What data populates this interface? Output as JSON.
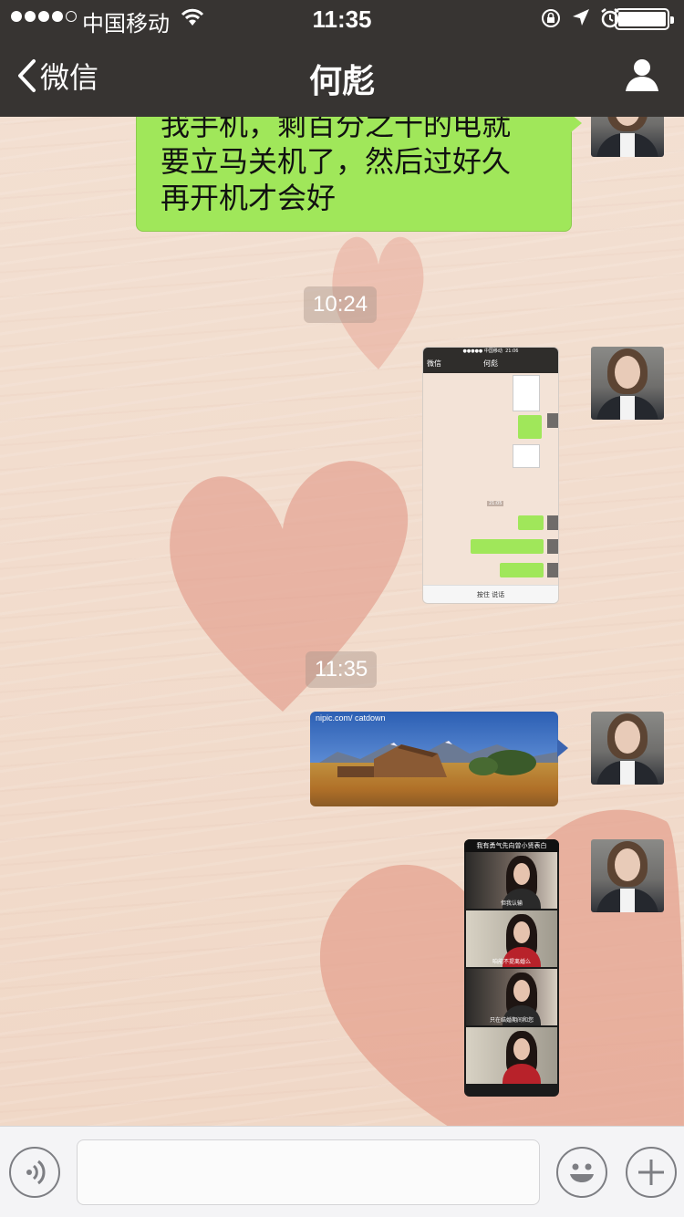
{
  "status_bar": {
    "carrier": "中国移动",
    "time": "11:35",
    "signal_bars_filled": 4,
    "signal_bars_total": 5,
    "battery_level": 1.0
  },
  "nav": {
    "back_label": "微信",
    "title": "何彪"
  },
  "messages": [
    {
      "type": "text",
      "sender": "me",
      "lines": [
        "我手机，剩百分之十的电就",
        "要立马关机了，然后过好久",
        "再开机才会好"
      ]
    },
    {
      "type": "timestamp",
      "text": "10:24"
    },
    {
      "type": "image",
      "sender": "me",
      "content": "screenshot",
      "thumbnail": {
        "status_carrier": "●●●●● 中国移动",
        "status_time": "21:06",
        "back_label": "微信",
        "title": "何彪",
        "time_badge": "21:05",
        "input_label": "按住 说话"
      }
    },
    {
      "type": "timestamp",
      "text": "11:35"
    },
    {
      "type": "image",
      "sender": "me",
      "content": "landscape-photo",
      "watermark": "nipic.com/ catdown"
    },
    {
      "type": "image",
      "sender": "me",
      "content": "meme-strip",
      "caption": "我有勇气先向曾小贤表白",
      "subtitles": [
        "但我认输",
        "咱能不提离婚么",
        "只在结婚期间和您",
        ""
      ]
    }
  ],
  "input_bar": {
    "voice_icon": "voice-icon",
    "emoji_icon": "emoji-icon",
    "plus_icon": "plus-icon",
    "text_value": ""
  },
  "colors": {
    "nav_bg": "#373432",
    "bubble_green": "#a0e75a",
    "heart_pink": "#e3a08f"
  }
}
